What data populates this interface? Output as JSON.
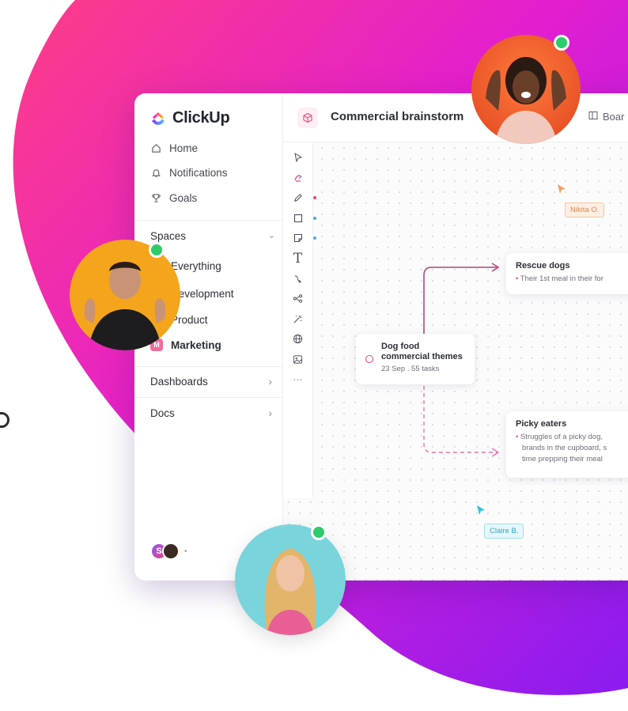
{
  "colors": {
    "blob_start": "#ff4d8d",
    "blob_end": "#8a2be2",
    "online": "#2dcb6a",
    "accent_pink": "#e8437c",
    "cursor_orange": "#e8a36a",
    "cursor_cyan": "#2fc3d8"
  },
  "app": {
    "logo_text": "ClickUp",
    "nav": [
      {
        "label": "Home",
        "icon": "home-icon"
      },
      {
        "label": "Notifications",
        "icon": "bell-icon"
      },
      {
        "label": "Goals",
        "icon": "trophy-icon"
      }
    ],
    "spaces_label": "Spaces",
    "spaces": [
      {
        "label": "Everything",
        "color": "#7b68ee"
      },
      {
        "label": "Development",
        "color": "#4fa8f0"
      },
      {
        "label": "Product",
        "color": "#f5a623"
      },
      {
        "label": "Marketing",
        "color": "#e8437c",
        "initial": "M"
      }
    ],
    "sections": [
      {
        "label": "Dashboards"
      },
      {
        "label": "Docs"
      }
    ],
    "user_initial": "S"
  },
  "topbar": {
    "title": "Commercial brainstorm",
    "view_label": "Boar"
  },
  "whiteboard": {
    "cursors": [
      {
        "name": "Nikita O."
      },
      {
        "name": "Claire B."
      }
    ],
    "center_card": {
      "title_line1": "Dog food",
      "title_line2": "commercial themes",
      "date": "23 Sep",
      "tasks": "55 tasks"
    },
    "card_rescue": {
      "title": "Rescue dogs",
      "bullet": "Their 1st meal in their for"
    },
    "card_picky": {
      "title": "Picky eaters",
      "lines": [
        "Struggles of a picky dog,",
        "brands in the cupboard, s",
        "time prepping their meal"
      ]
    }
  }
}
